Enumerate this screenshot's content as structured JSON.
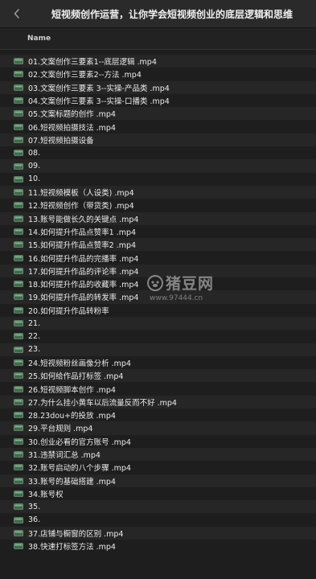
{
  "window": {
    "title": "短视频创作运营，让你学会短视频创业的底层逻辑和思维"
  },
  "header": {
    "name_column": "Name"
  },
  "icons": {
    "back": "chevron-left-icon",
    "file": "video-file-icon"
  },
  "watermark": {
    "text": "猪豆网",
    "url": "www.97444.cn"
  },
  "files": [
    "01.文案创作三要素1--底层逻辑 .mp4",
    "02.文案创作三要素2--方法 .mp4",
    "03.文案创作三要素 3--实操-产品类 .mp4",
    "04.文案创作三要素 3--实操-口播类 .mp4",
    "05.文案标题的创作 .mp4",
    "06.短视频拍摄技法 .mp4",
    "07.短视频拍摄设备",
    "08.",
    "09.",
    "10.",
    "11.短视频模板（人设类) .mp4",
    "12.短视频创作（带货类) .mp4",
    "13.账号能做长久的关键点 .mp4",
    "14.如何提升作品点赞率1 .mp4",
    "15.如何提升作品点赞率2 .mp4",
    "16.如何提升作品的完播率 .mp4",
    "17.如何提升作品的评论率 .mp4",
    "18.如何提升作品的收藏率 .mp4",
    "19.如何提升作品的转发率 .mp4",
    "20.如何提升作品转粉率",
    "21.",
    "22.",
    "23.",
    "24.短视频粉丝画像分析 .mp4",
    "25.如何给作品打标签 .mp4",
    "26.短视频脚本创作 .mp4",
    "27.为什么挂小黄车以后流量反而不好 .mp4",
    "28.23dou+的投放 .mp4",
    "29.平台规则 .mp4",
    "30.创业必看的官方账号 .mp4",
    "31.违禁词汇总 .mp4",
    "32.账号启动的八个步骤 .mp4",
    "33.账号的基础搭建 .mp4",
    "34.账号权",
    "35.",
    "36.",
    "37.店铺与橱窗的区别 .mp4",
    "38.快速打标签方法 .mp4"
  ]
}
